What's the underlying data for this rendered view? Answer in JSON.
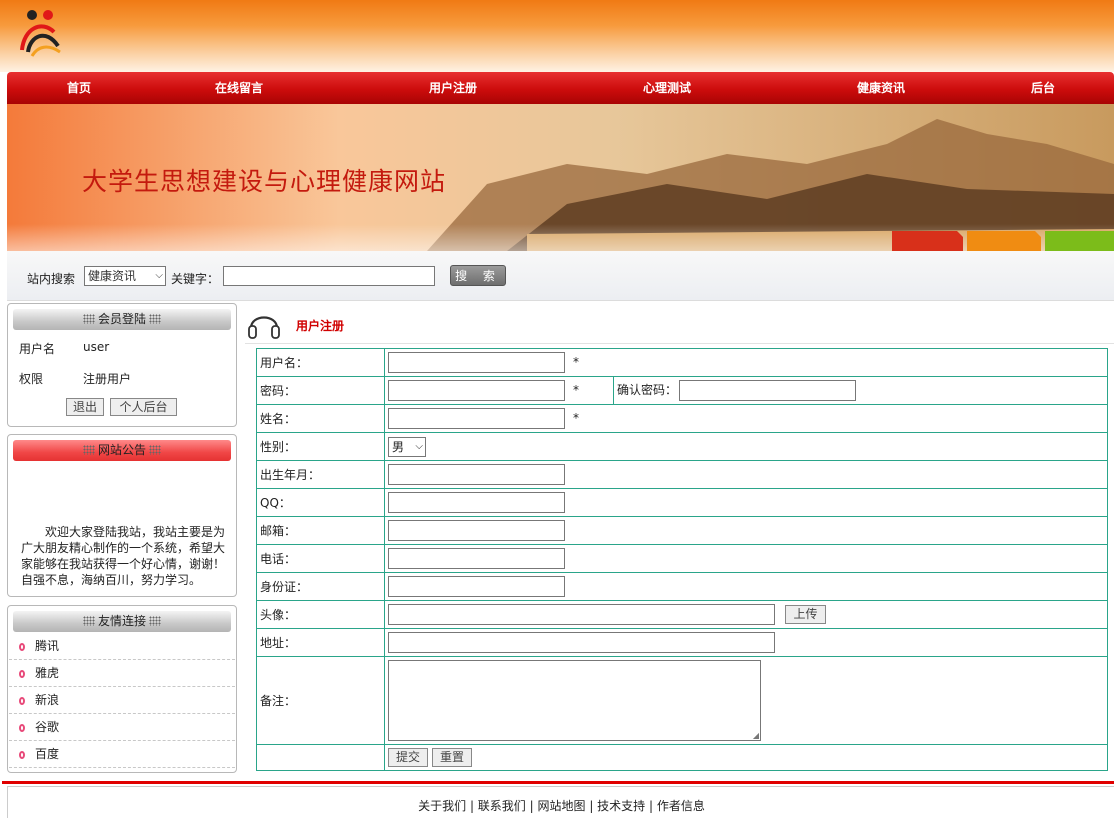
{
  "nav": [
    "首页",
    "在线留言",
    "用户注册",
    "心理测试",
    "健康资讯",
    "后台"
  ],
  "banner": {
    "title": "大学生思想建设与心理健康网站"
  },
  "search": {
    "label": "站内搜索",
    "category": "健康资讯",
    "keyword_label": "关键字：",
    "keyword_value": "",
    "button": "搜 索"
  },
  "login_box": {
    "title": "会员登陆",
    "username_label": "用户名",
    "username": "user",
    "role_label": "权限",
    "role": "注册用户",
    "logout_button": "退出",
    "admin_button": "个人后台"
  },
  "notice_box": {
    "title": "网站公告",
    "text": "欢迎大家登陆我站，我站主要是为广大朋友精心制作的一个系统，希望大家能够在我站获得一个好心情，谢谢！　　自强不息，海纳百川，努力学习。"
  },
  "links_box": {
    "title": "友情连接",
    "items": [
      "腾讯",
      "雅虎",
      "新浪",
      "谷歌",
      "百度"
    ]
  },
  "main": {
    "title": "用户注册"
  },
  "form": {
    "username_label": "用户名：",
    "password_label": "密码：",
    "confirm_password_label": "确认密码：",
    "realname_label": "姓名：",
    "gender_label": "性别：",
    "gender_value": "男",
    "birth_label": "出生年月：",
    "qq_label": "QQ：",
    "email_label": "邮箱：",
    "phone_label": "电话：",
    "idcard_label": "身份证：",
    "avatar_label": "头像：",
    "upload_button": "上传",
    "address_label": "地址：",
    "remark_label": "备注：",
    "required_mark": "*",
    "submit_button": "提交",
    "reset_button": "重置"
  },
  "footer": {
    "links": [
      "关于我们",
      "联系我们",
      "网站地图",
      "技术支持",
      "作者信息"
    ],
    "separator": " | "
  },
  "colors": {
    "nav_red": "#cc0c0c",
    "title_red": "#d00000",
    "table_border": "#2aa58a",
    "header_orange": "#f07a14"
  }
}
